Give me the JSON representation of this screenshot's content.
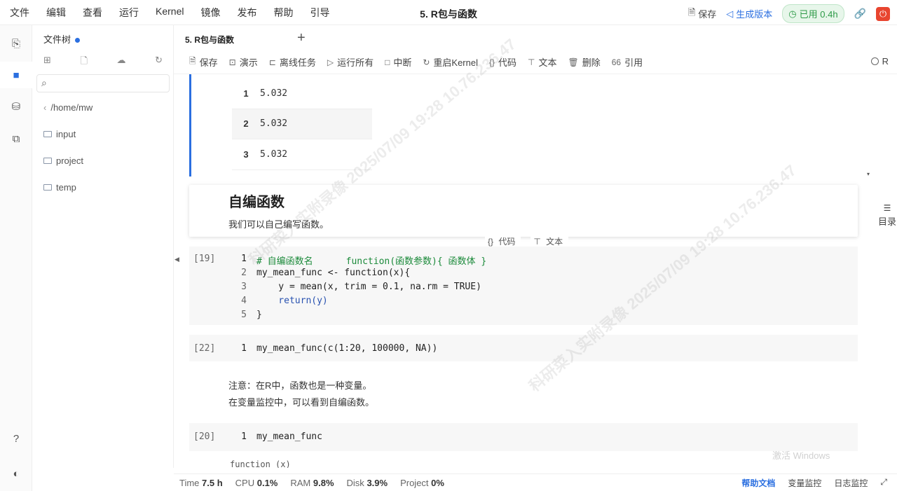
{
  "menubar": {
    "items": [
      "文件",
      "编辑",
      "查看",
      "运行",
      "Kernel",
      "镜像",
      "发布",
      "帮助",
      "引导"
    ],
    "title": "5. R包与函数",
    "save": "保存",
    "generate_version": "生成版本",
    "used": "已用 0.4h"
  },
  "filetree": {
    "title": "文件树",
    "path": "/home/mw",
    "items": [
      "input",
      "project",
      "temp"
    ]
  },
  "tab": {
    "label": "5. R包与函数",
    "add": "+"
  },
  "toolbar": {
    "save": "保存",
    "present": "演示",
    "offline": "离线任务",
    "run_all": "运行所有",
    "interrupt": "中断",
    "restart": "重启Kernel",
    "code": "代码",
    "text": "文本",
    "delete": "删除",
    "cite": "引用",
    "kernel": "R"
  },
  "output_table": [
    {
      "idx": "1",
      "value": "5.032"
    },
    {
      "idx": "2",
      "value": "5.032"
    },
    {
      "idx": "3",
      "value": "5.032"
    }
  ],
  "markdown1": {
    "heading": "自编函数",
    "body": "我们可以自己编写函数。"
  },
  "cell_actions": {
    "code": "代码",
    "text": "文本"
  },
  "cell19": {
    "prompt": "[19]",
    "lines": [
      {
        "no": "1",
        "text": "# 自编函数名      function(函数参数){ 函数体 }"
      },
      {
        "no": "2",
        "text": "my_mean_func <- function(x){"
      },
      {
        "no": "3",
        "text": "    y = mean(x, trim = 0.1, na.rm = TRUE)"
      },
      {
        "no": "4",
        "text": "    return(y)"
      },
      {
        "no": "5",
        "text": "}"
      }
    ]
  },
  "cell22": {
    "prompt": "[22]",
    "no": "1",
    "text": "my_mean_func(c(1:20, 100000, NA))"
  },
  "note": {
    "line1": "注意：在R中，函数也是一种变量。",
    "line2": "在变量监控中，可以看到自编函数。"
  },
  "cell20": {
    "prompt": "[20]",
    "no": "1",
    "text": "my_mean_func",
    "output": "function (x)"
  },
  "toc": "目录",
  "status": {
    "time_label": "Time",
    "time": "7.5 h",
    "cpu_label": "CPU",
    "cpu": "0.1%",
    "ram_label": "RAM",
    "ram": "9.8%",
    "disk_label": "Disk",
    "disk": "3.9%",
    "project_label": "Project",
    "project": "0%",
    "help": "帮助文档",
    "vars": "变量监控",
    "logs": "日志监控"
  },
  "os_watermark": "激活 Windows",
  "watermark_text": "科研菜入实附录像 2025/07/09 19:28 10.76.236.47"
}
